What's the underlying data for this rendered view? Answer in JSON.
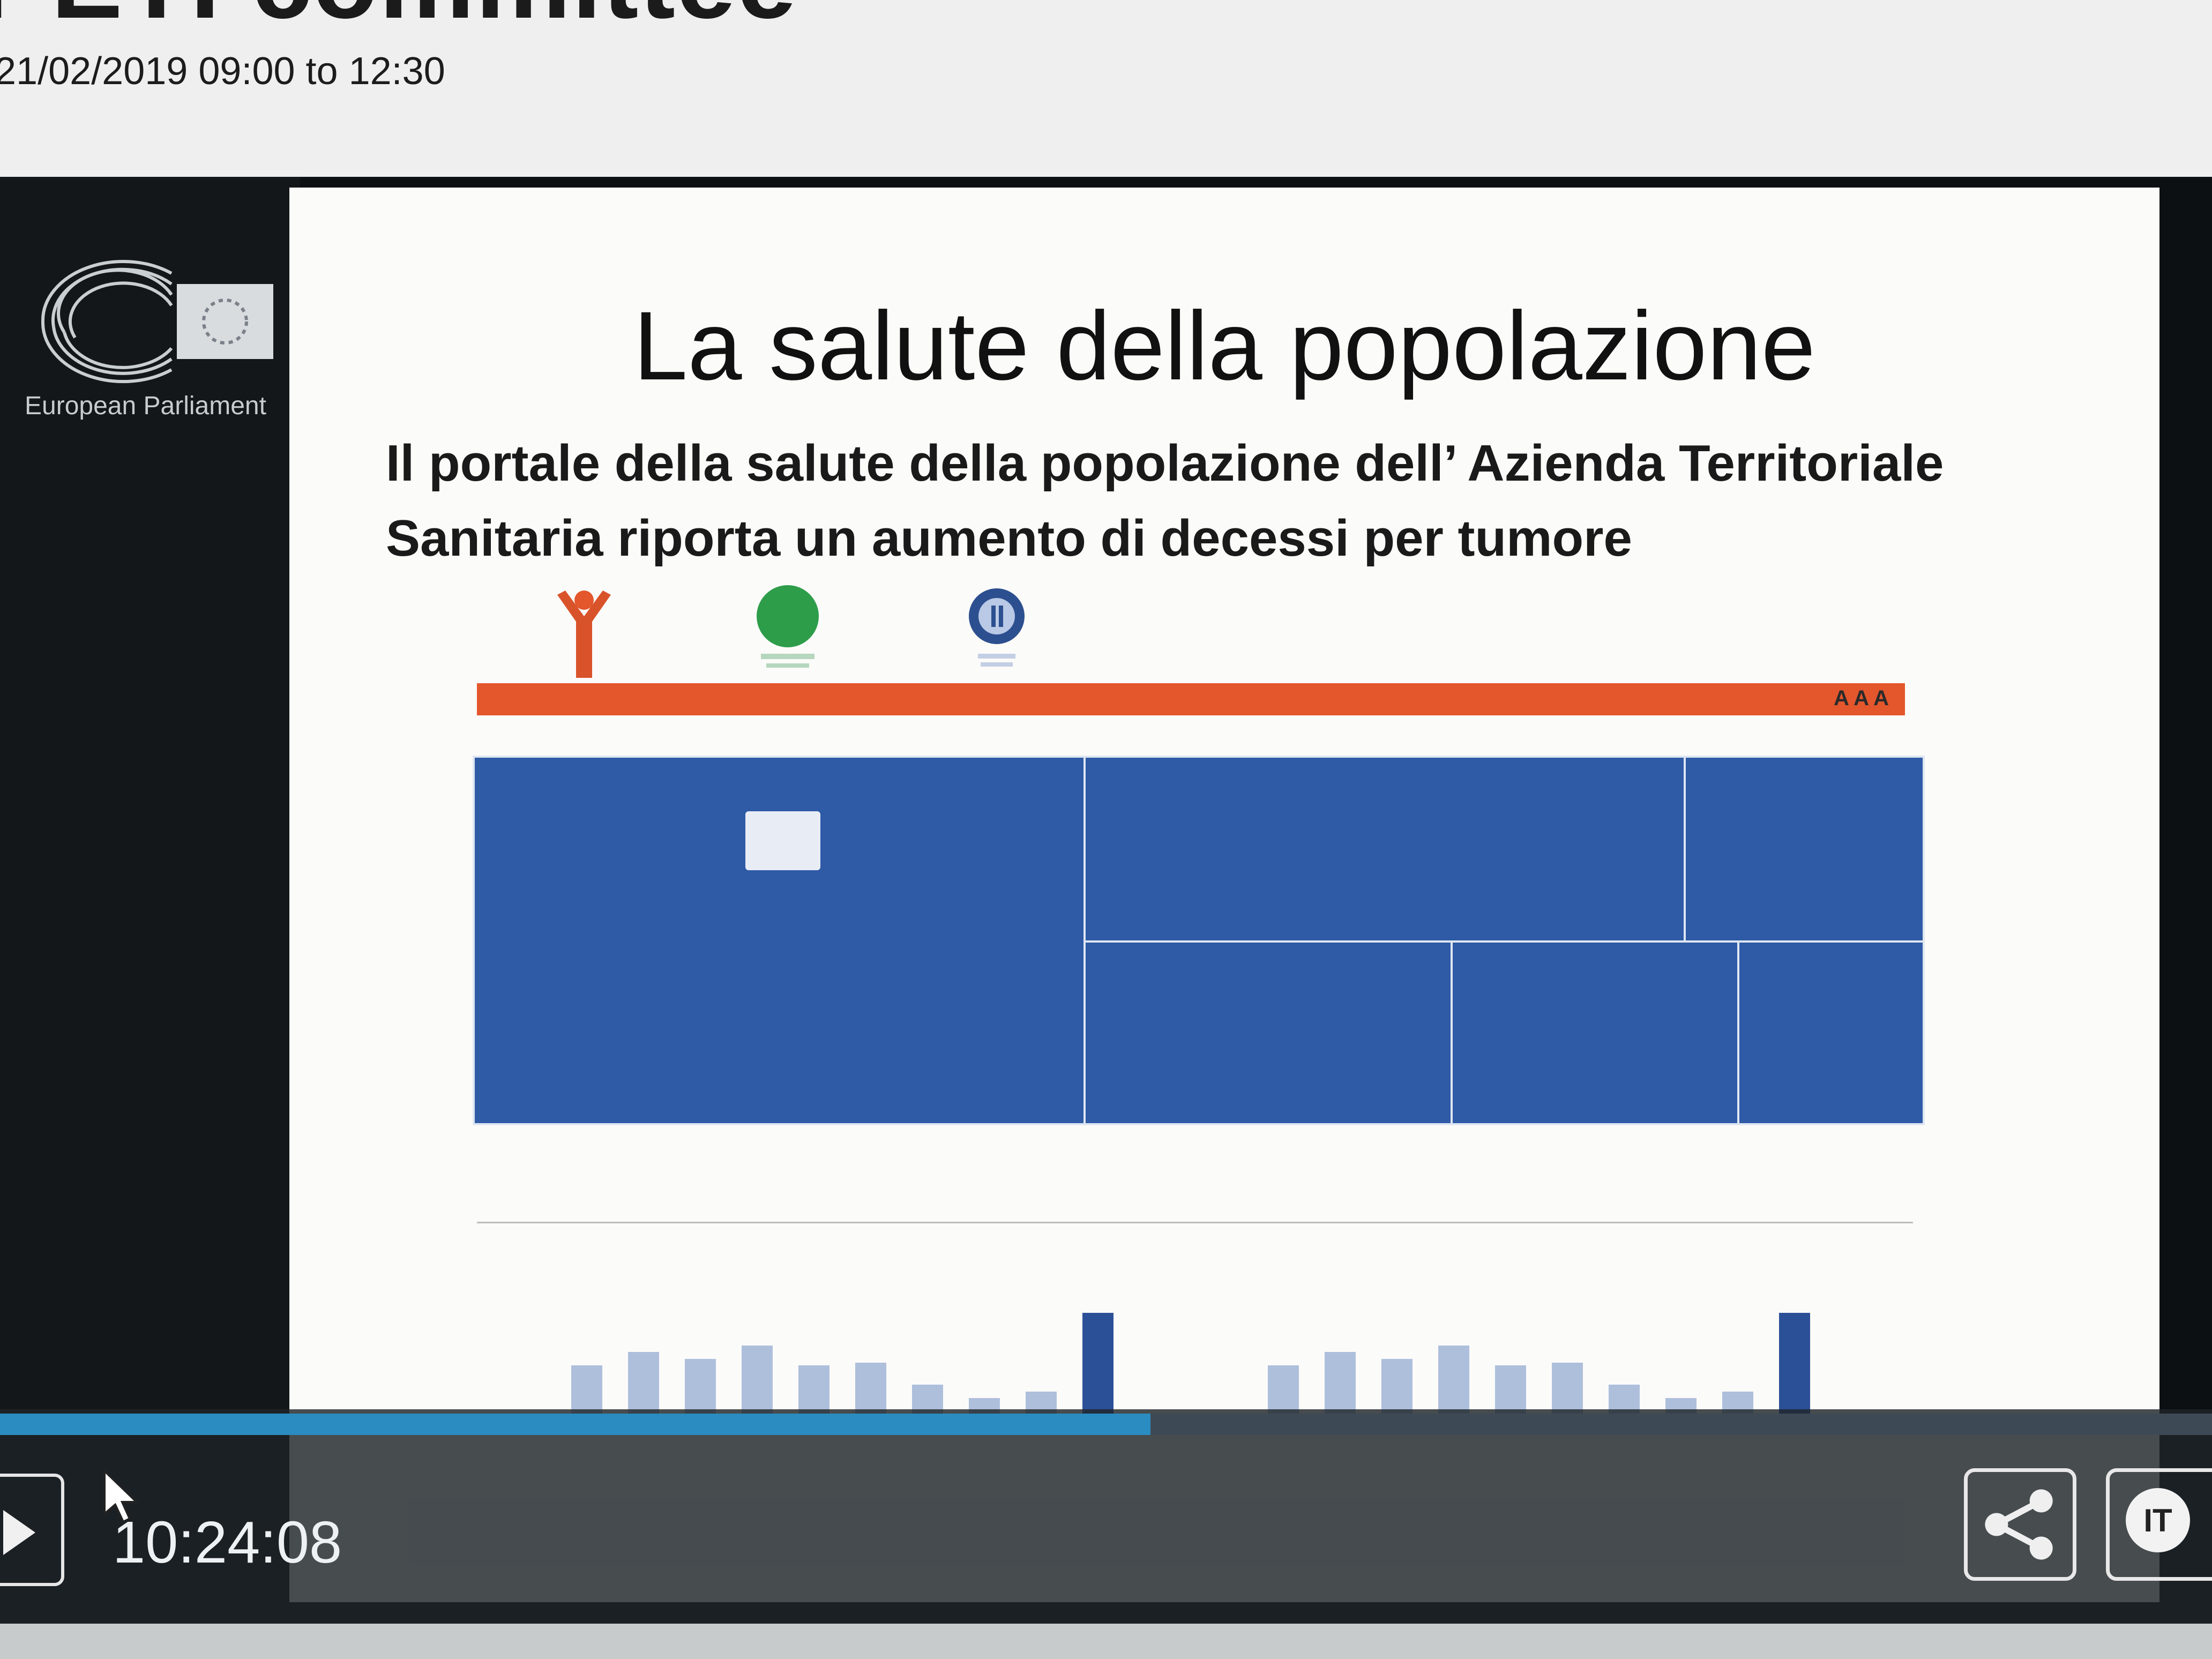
{
  "header": {
    "title": "PETI committee",
    "session_time": "21/02/2019 09:00 to 12:30"
  },
  "player": {
    "logo_label": "European Parliament",
    "timecode": "10:24:08",
    "progress": 0.52,
    "language": "IT",
    "accent_color": "#2a8cc0"
  },
  "slide": {
    "title": "La salute della popolazione",
    "subtitle_line1": "Il portale della salute della popolazione dell’ Azienda Territoriale",
    "subtitle_line2": "Sanitaria riporta un aumento di decessi per tumore",
    "orange_bar_color": "#e4562c",
    "orange_bar_tools": "A A A",
    "tile_color": "#2e5aa6",
    "icons": [
      "person-icon",
      "green-circle-icon",
      "blue-circle-icon"
    ]
  },
  "chart_data": [
    {
      "type": "bar",
      "series": [
        {
          "values": [
            1,
            5,
            6,
            5.5,
            6.5,
            5,
            5.2,
            3.5,
            2.5,
            3,
            9
          ]
        }
      ],
      "highlight_index": 10
    },
    {
      "type": "bar",
      "series": [
        {
          "values": [
            1,
            5,
            6,
            5.5,
            6.5,
            5,
            5.2,
            3.5,
            2.5,
            3,
            9
          ]
        }
      ],
      "highlight_index": 10
    }
  ]
}
